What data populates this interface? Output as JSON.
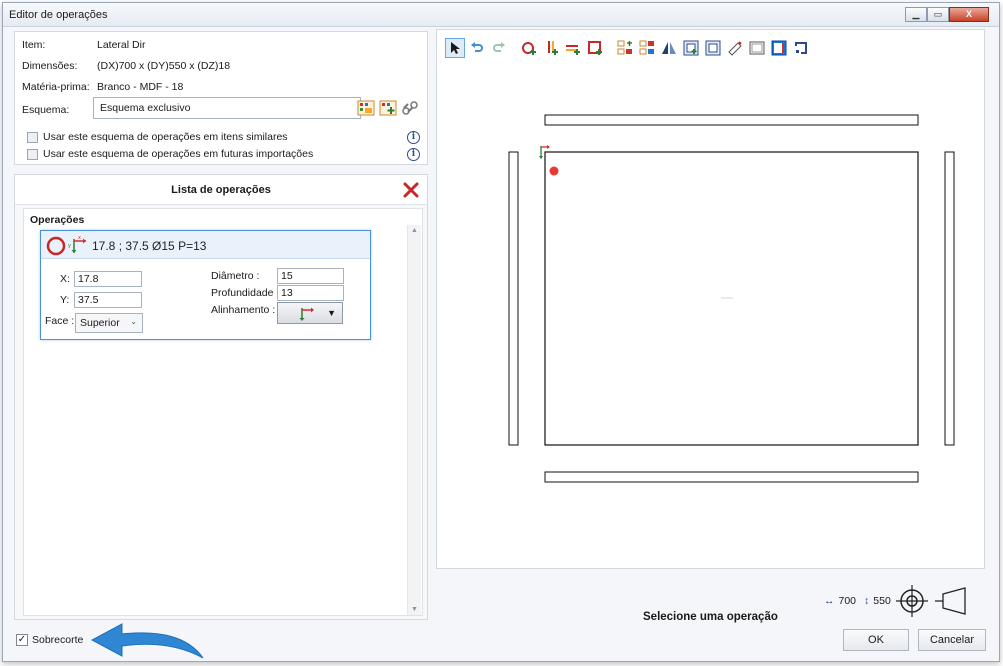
{
  "window": {
    "title": "Editor de operações",
    "controls": {
      "minimize": "▁",
      "maximize": "▭",
      "close": "X"
    }
  },
  "info": {
    "item_label": "Item:",
    "item_value": "Lateral Dir",
    "dims_label": "Dimensões:",
    "dims_value": "(DX)700 x (DY)550 x (DZ)18",
    "material_label": "Matéria-prima:",
    "material_value": "Branco - MDF - 18",
    "schema_label": "Esquema:",
    "schema_value": "Esquema exclusivo",
    "check_similar": "Usar este esquema de operações em itens similares",
    "check_future": "Usar este esquema de operações em futuras importações"
  },
  "operations": {
    "panel_title": "Lista de operações",
    "section_label": "Operações",
    "selected": {
      "summary": "17.8 ; 37.5 Ø15 P=13",
      "x_label": "X:",
      "x_value": "17.8",
      "y_label": "Y:",
      "y_value": "37.5",
      "face_label": "Face :",
      "face_value": "Superior",
      "diameter_label": "Diâmetro :",
      "diameter_value": "15",
      "depth_label": "Profundidade :",
      "depth_value": "13",
      "alignment_label": "Alinhamento :"
    }
  },
  "toolbar": {
    "icons": [
      "pointer-icon",
      "undo-icon",
      "redo-icon",
      "add-hole-icon",
      "add-groove-icon",
      "add-cut-icon",
      "add-pocket-icon",
      "copy-ops-icon",
      "move-ops-icon",
      "mirror-icon",
      "panel-view-icon",
      "frame-icon",
      "measure-icon",
      "rectangle-icon",
      "fill-icon",
      "rotate-icon"
    ]
  },
  "canvas": {
    "dx": "700",
    "dy": "550",
    "status": "Selecione uma operação",
    "colors": {
      "hole": "#e53935",
      "axis_x": "#d32f2f",
      "axis_y": "#2e7d32"
    }
  },
  "footer": {
    "sobrecorte_label": "Sobrecorte",
    "ok_label": "OK",
    "cancel_label": "Cancelar"
  }
}
